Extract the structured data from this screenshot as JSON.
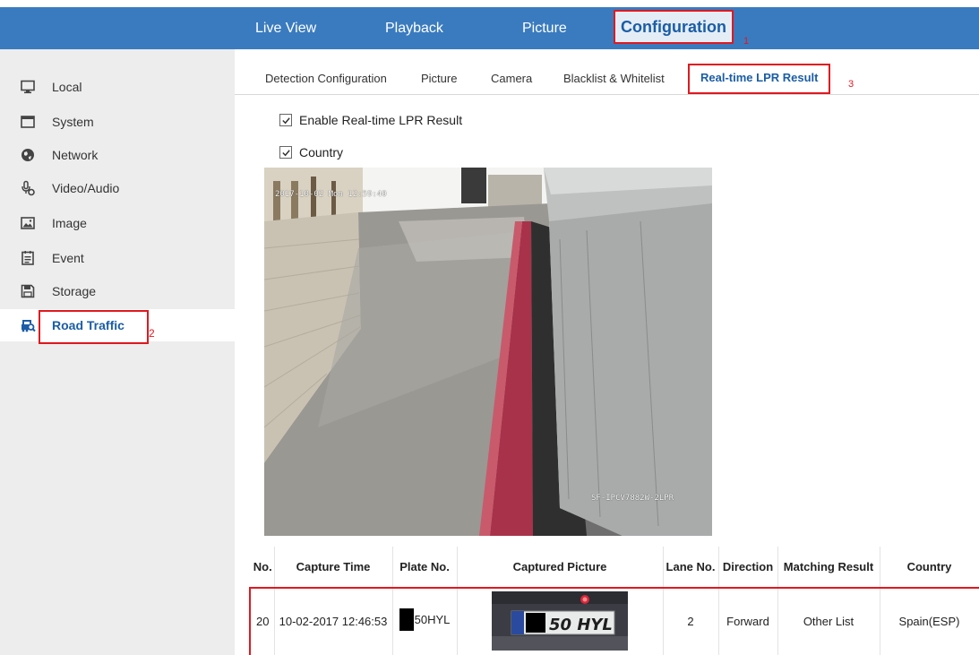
{
  "nav": {
    "items": [
      "Live View",
      "Playback",
      "Picture",
      "Configuration"
    ],
    "active": "Configuration"
  },
  "callouts": [
    "1",
    "2",
    "3"
  ],
  "sidebar": {
    "items": [
      {
        "label": "Local",
        "icon": "monitor-icon"
      },
      {
        "label": "System",
        "icon": "system-window-icon"
      },
      {
        "label": "Network",
        "icon": "globe-icon"
      },
      {
        "label": "Video/Audio",
        "icon": "microphone-icon"
      },
      {
        "label": "Image",
        "icon": "image-icon"
      },
      {
        "label": "Event",
        "icon": "event-list-icon"
      },
      {
        "label": "Storage",
        "icon": "floppy-disk-icon"
      },
      {
        "label": "Road Traffic",
        "icon": "vehicle-search-icon"
      }
    ],
    "active": "Road Traffic"
  },
  "subtabs": {
    "items": [
      "Detection Configuration",
      "Picture",
      "Camera",
      "Blacklist & Whitelist",
      "Real-time LPR Result"
    ],
    "active": "Real-time LPR Result"
  },
  "options": {
    "enable_label": "Enable Real-time LPR Result",
    "enable_checked": true,
    "country_label": "Country",
    "country_checked": true
  },
  "camera": {
    "timestamp": "2017-10-02 Mon 12:59:40",
    "camera_name": "SF-IPCV7882W-2LPR"
  },
  "table": {
    "headers": [
      "No.",
      "Capture Time",
      "Plate No.",
      "Captured Picture",
      "Lane No.",
      "Direction",
      "Matching Result",
      "Country"
    ],
    "rows": [
      {
        "no": "20",
        "capture_time": "10-02-2017 12:46:53",
        "plate_no": "50HYL",
        "plate_image_text": "50 HYL",
        "lane": "2",
        "direction": "Forward",
        "matching_result": "Other List",
        "country": "Spain(ESP)"
      }
    ]
  },
  "colors": {
    "nav_bar": "#3a7bbf",
    "active_text": "#1a5da6",
    "highlight_box": "#e0181f",
    "sidebar_bg": "#ededed"
  }
}
